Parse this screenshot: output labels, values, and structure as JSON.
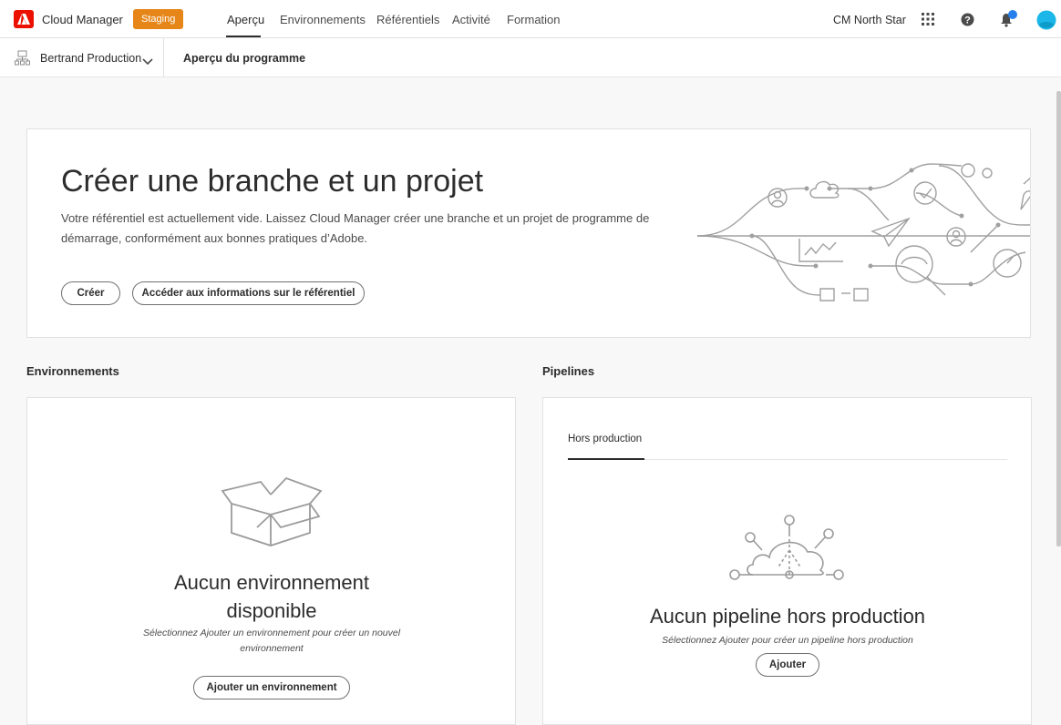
{
  "header": {
    "app_name": "Cloud Manager",
    "env_badge": "Staging",
    "nav": [
      {
        "label": "Aperçu",
        "active": true
      },
      {
        "label": "Environnements",
        "active": false
      },
      {
        "label": "Référentiels",
        "active": false
      },
      {
        "label": "Activité",
        "active": false
      },
      {
        "label": "Formation",
        "active": false
      }
    ],
    "org_name": "CM North Star",
    "icons": [
      "apps-grid-icon",
      "help-icon",
      "bell-icon",
      "avatar"
    ]
  },
  "subheader": {
    "program_name": "Bertrand Production",
    "page_title": "Aperçu du programme"
  },
  "hero": {
    "title": "Créer une branche et un projet",
    "description": "Votre référentiel est actuellement vide. Laissez Cloud Manager créer une branche et un projet de programme de démarrage, conformément aux bonnes pratiques d’Adobe.",
    "create_button": "Créer",
    "repo_info_button": "Accéder aux informations sur le référentiel"
  },
  "environments": {
    "section_title": "Environnements",
    "empty_title": "Aucun environnement disponible",
    "empty_desc": "Sélectionnez Ajouter un environnement pour créer un nouvel environnement",
    "add_button": "Ajouter un environnement"
  },
  "pipelines": {
    "section_title": "Pipelines",
    "tab_label": "Hors production",
    "empty_title": "Aucun pipeline hors production",
    "empty_desc": "Sélectionnez Ajouter pour créer un pipeline hors production",
    "add_button": "Ajouter"
  },
  "colors": {
    "adobe_red": "#eb1000",
    "staging_orange": "#e68619",
    "notification_blue": "#2680eb",
    "avatar_cyan": "#1ab7e8"
  }
}
